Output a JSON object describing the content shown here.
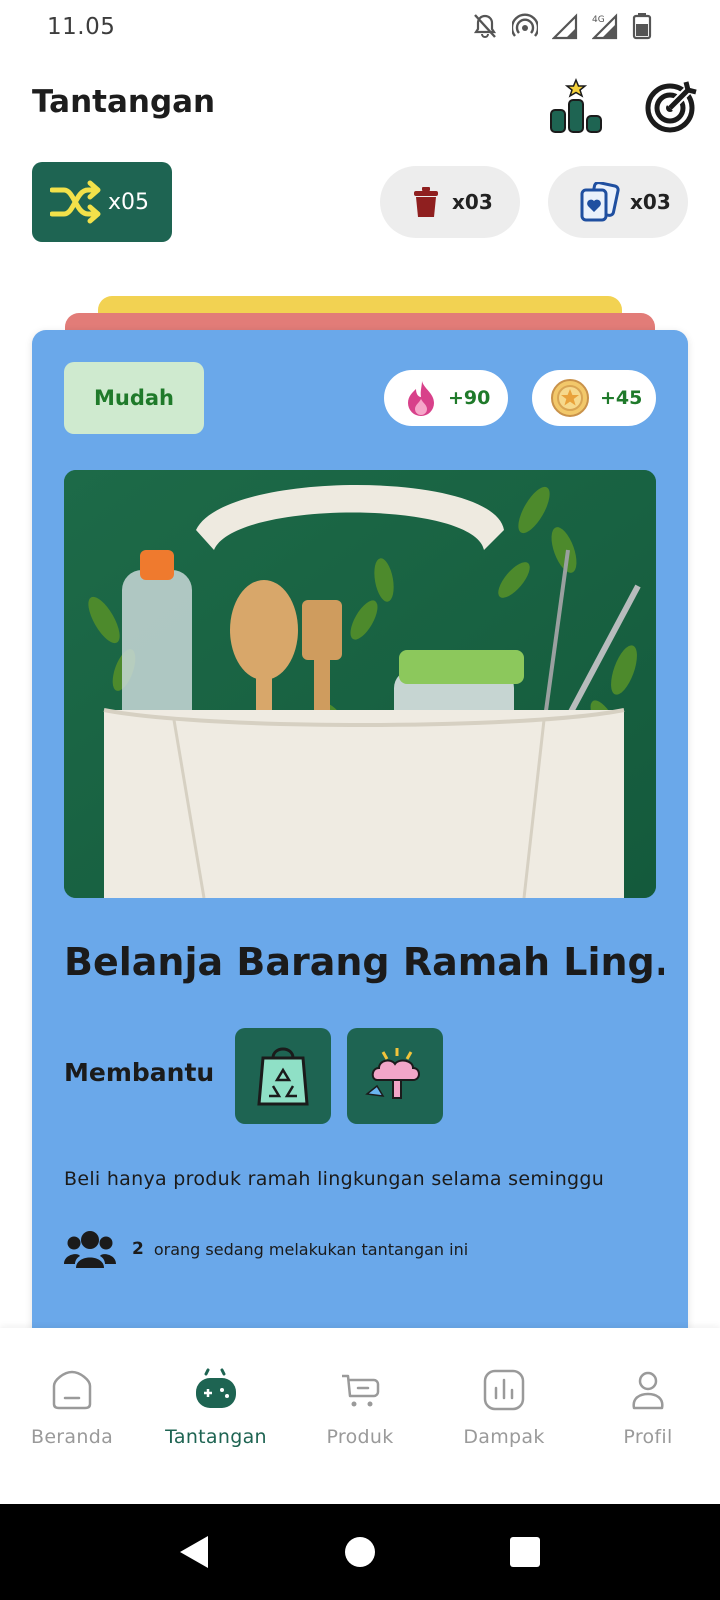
{
  "status_bar": {
    "time": "11.05",
    "icons": [
      "bell-off-icon",
      "hotspot-icon",
      "signal-icon",
      "signal-4g-icon",
      "battery-icon"
    ]
  },
  "header": {
    "title": "Tantangan",
    "icons": [
      "leaderboard-icon",
      "target-icon"
    ]
  },
  "powerups": {
    "shuffle": "x05",
    "trash": "x03",
    "cards": "x03"
  },
  "card": {
    "difficulty": "Mudah",
    "xp_reward": "+90",
    "coin_reward": "+45",
    "image": "tote-bag-with-eco-products",
    "title": "Belanja Barang Ramah Ling...",
    "helps_label": "Membantu",
    "helps_icons": [
      "recycle-bag-icon",
      "pollution-icon"
    ],
    "description": "Beli hanya produk ramah lingkungan selama seminggu",
    "participants_count": "2",
    "participants_text": "orang sedang melakukan tantangan ini"
  },
  "nav": {
    "items": [
      {
        "label": "Beranda",
        "icon": "home-icon"
      },
      {
        "label": "Tantangan",
        "icon": "gamepad-icon"
      },
      {
        "label": "Produk",
        "icon": "cart-icon"
      },
      {
        "label": "Dampak",
        "icon": "chart-icon"
      },
      {
        "label": "Profil",
        "icon": "user-icon"
      }
    ],
    "active": "Tantangan"
  },
  "colors": {
    "primary": "#1e6452",
    "card_bg": "#6aa8ea",
    "stack_yellow": "#f2d252",
    "stack_red": "#e27c78",
    "easy_badge_bg": "#cfeacf",
    "easy_badge_text": "#1f7a2a"
  }
}
